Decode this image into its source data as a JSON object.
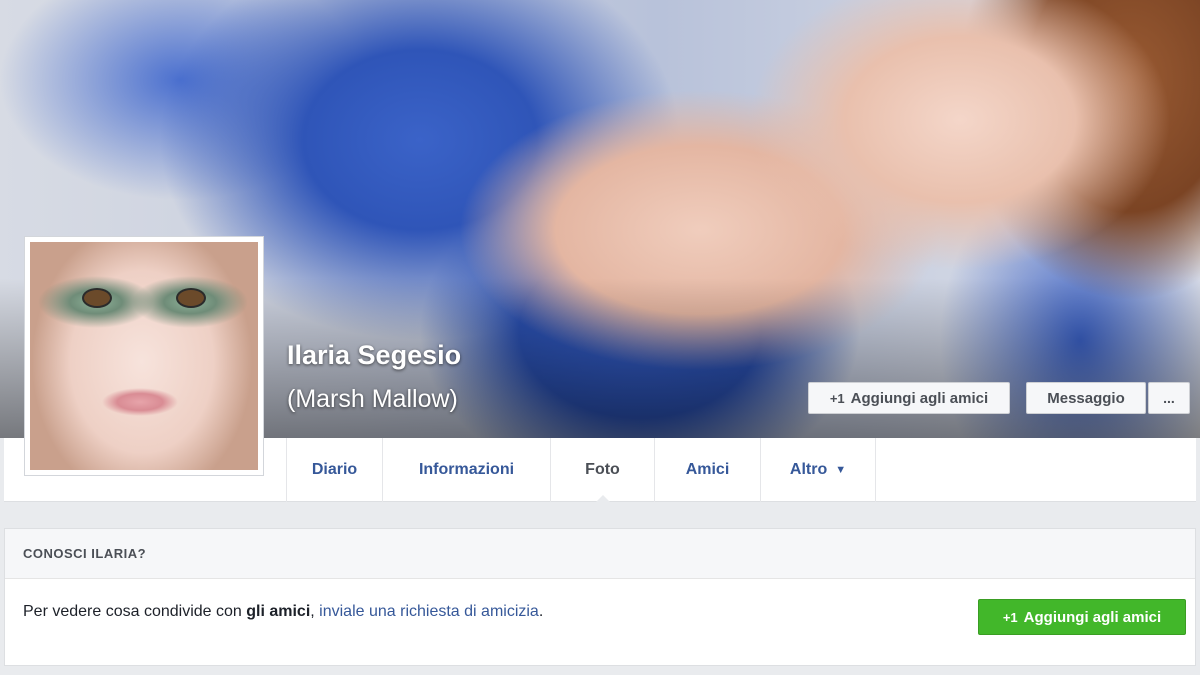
{
  "profile": {
    "name": "Ilaria Segesio",
    "alternate_name": "(Marsh Mallow)"
  },
  "cover_actions": {
    "add_friend_icon": "+1",
    "add_friend": "Aggiungi agli amici",
    "message": "Messaggio",
    "more": "..."
  },
  "tabs": [
    {
      "label": "Diario"
    },
    {
      "label": "Informazioni"
    },
    {
      "label": "Foto"
    },
    {
      "label": "Amici"
    },
    {
      "label": "Altro"
    }
  ],
  "tab_chevron": "▼",
  "know_panel": {
    "title": "CONOSCI ILARIA?",
    "text_prefix": "Per vedere cosa condivide con ",
    "text_bold": "gli amici",
    "text_mid": ", ",
    "text_link": "inviale una richiesta di amicizia",
    "text_suffix": ".",
    "button_icon": "+1",
    "button_label": "Aggiungi agli amici"
  },
  "colors": {
    "link": "#365899",
    "green_button": "#42b72a",
    "background": "#e9ebee"
  }
}
